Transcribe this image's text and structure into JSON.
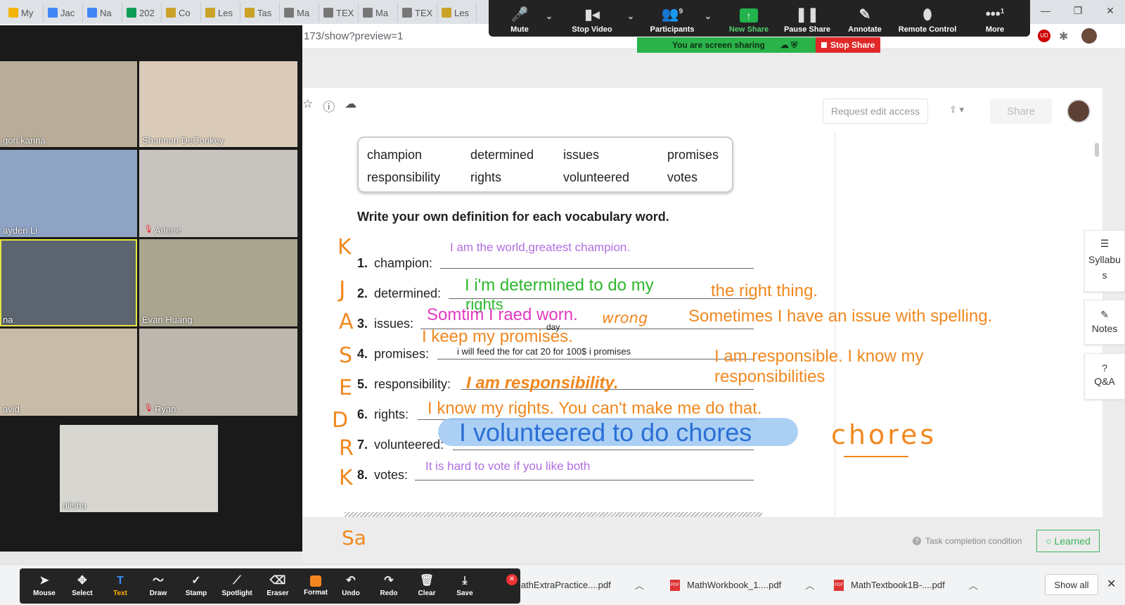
{
  "browser": {
    "tabs": [
      {
        "label": "My",
        "color": "#f4b400"
      },
      {
        "label": "Jac",
        "color": "#4285f4"
      },
      {
        "label": "Na",
        "color": "#4285f4"
      },
      {
        "label": "202",
        "color": "#0f9d58"
      },
      {
        "label": "Co",
        "color": "#c9a227"
      },
      {
        "label": "Les",
        "color": "#c9a227"
      },
      {
        "label": "Tas",
        "color": "#c9a227"
      },
      {
        "label": "Ma",
        "color": "#777777"
      },
      {
        "label": "TEX",
        "color": "#777777"
      },
      {
        "label": "Ma",
        "color": "#777777"
      },
      {
        "label": "TEX",
        "color": "#777777"
      },
      {
        "label": "Les",
        "color": "#c9a227"
      }
    ],
    "url": "173/show?preview=1",
    "ext_badge": "UD"
  },
  "zoom_toolbar": {
    "mute": "Mute",
    "stop_video": "Stop Video",
    "participants": "Participants",
    "participants_count": "9",
    "new_share": "New Share",
    "pause_share": "Pause Share",
    "annotate": "Annotate",
    "remote_control": "Remote Control",
    "more": "More",
    "more_badge": "1",
    "screen_sharing": "You are screen sharing",
    "stop_share": "Stop Share"
  },
  "gallery": {
    "tiles": [
      {
        "name": "gon karina",
        "bg": "#b9ad9a",
        "muted": false
      },
      {
        "name": "Shannon DeConkey",
        "bg": "#d9cbb8",
        "muted": false
      },
      {
        "name": "ayden Li",
        "bg": "#8fa3c5",
        "muted": false
      },
      {
        "name": "Arlene",
        "bg": "#c7c4bf",
        "muted": true
      },
      {
        "name": "na",
        "bg": "#5c6470",
        "muted": false
      },
      {
        "name": "Evan Huang",
        "bg": "#a9a58e",
        "muted": false
      },
      {
        "name": "avid",
        "bg": "#c8bba8",
        "muted": false
      },
      {
        "name": "Ryan",
        "bg": "#bdb7ad",
        "muted": true
      },
      {
        "name": "alisha",
        "bg": "#d8d6d0",
        "muted": false
      }
    ]
  },
  "doc": {
    "request_edit": "Request edit access",
    "share": "Share",
    "words": [
      "champion",
      "determined",
      "issues",
      "promises",
      "responsibility",
      "rights",
      "volunteered",
      "votes"
    ],
    "heading": "Write your own definition for each vocabulary word.",
    "questions": [
      {
        "num": "1.",
        "label": "champion:"
      },
      {
        "num": "2.",
        "label": "determined:"
      },
      {
        "num": "3.",
        "label": "issues:"
      },
      {
        "num": "4.",
        "label": "promises:"
      },
      {
        "num": "5.",
        "label": "responsibility:"
      },
      {
        "num": "6.",
        "label": "rights:"
      },
      {
        "num": "7.",
        "label": "volunteered:"
      },
      {
        "num": "8.",
        "label": "votes:"
      }
    ],
    "task_condition": "Task completion condition",
    "learned": "Learned"
  },
  "annotations": {
    "a1": "I am the world,greatest champion.",
    "a2": "I i'm determined to do my",
    "a2b": "rights",
    "a2c": "the right thing.",
    "a3": "Somtim I raed worn.",
    "a3b": "wrong",
    "a3c": "Sometimes I have an issue with spelling.",
    "a3d": "day",
    "a4": "I keep my promises.",
    "a4b": "i will feed the for cat 20 for 100$ i promises",
    "a4c": "I am responsible.  I know my",
    "a4d": "responsibilities",
    "a5": "I am responsibility.",
    "a6": "I know my rights.  You can't make me do that.",
    "a7": "I volunteered to do chores",
    "a7b": "chores",
    "a8": "It is hard to vote if you like both",
    "letters": [
      "K",
      "J",
      "A",
      "S",
      "E",
      "D",
      "R",
      "K"
    ],
    "sa": "Sa"
  },
  "sidebar": {
    "syllabus": "Syllabus",
    "notes": "Notes",
    "qa": "Q&A"
  },
  "downloads": {
    "files": [
      "MathExtraPractice....pdf",
      "MathWorkbook_1....pdf",
      "MathTextbook1B-....pdf"
    ],
    "show_all": "Show all"
  },
  "annotate_toolbar": {
    "mouse": "Mouse",
    "select": "Select",
    "text": "Text",
    "draw": "Draw",
    "stamp": "Stamp",
    "spotlight": "Spotlight",
    "eraser": "Eraser",
    "format": "Format",
    "undo": "Undo",
    "redo": "Redo",
    "clear": "Clear",
    "save": "Save"
  }
}
